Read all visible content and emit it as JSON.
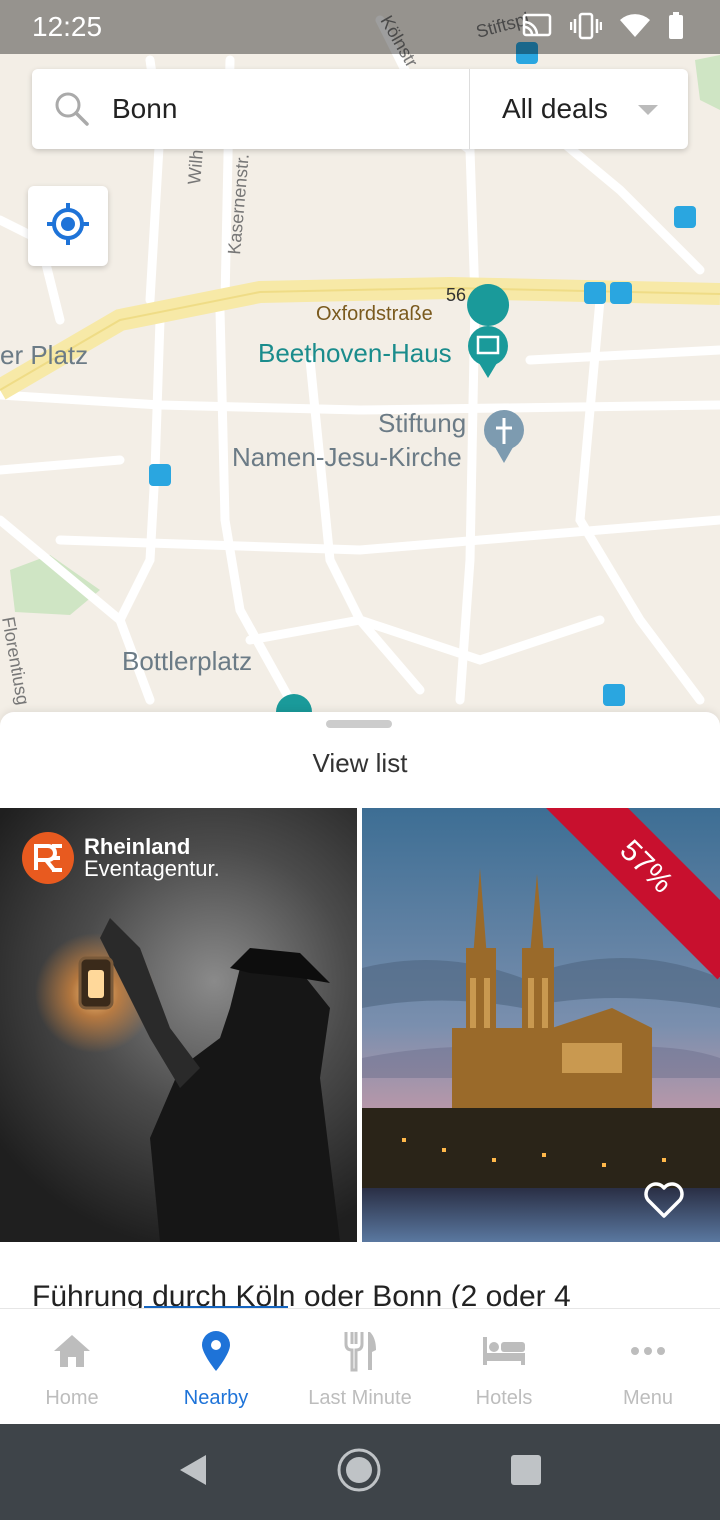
{
  "status_bar": {
    "time": "12:25"
  },
  "search": {
    "query": "Bonn",
    "deals_filter": "All deals"
  },
  "map": {
    "labels": {
      "beethoven": "Beethoven-Haus",
      "church_line1": "Stiftung",
      "church_line2": "Namen-Jesu-Kirche",
      "bottlerplatz": "Bottlerplatz",
      "platz": "er Platz",
      "oxford": "Oxfordstraße",
      "route": "56",
      "kasernen": "Kasernenstr.",
      "wilhelm": "Wilh",
      "koln": "Kölnstr",
      "stifts": "Stiftspl",
      "florentius": "Florentiusg"
    }
  },
  "sheet": {
    "view_list": "View list",
    "card_left": {
      "brand_line1": "Rheinland",
      "brand_line2": "Eventagentur."
    },
    "card_right": {
      "discount": "57%"
    },
    "deal_title": "Führung durch Köln oder Bonn (2 oder 4"
  },
  "nav": {
    "items": [
      {
        "label": "Home",
        "icon": "home-icon"
      },
      {
        "label": "Nearby",
        "icon": "location-pin-icon"
      },
      {
        "label": "Last Minute",
        "icon": "cutlery-icon"
      },
      {
        "label": "Hotels",
        "icon": "bed-icon"
      },
      {
        "label": "Menu",
        "icon": "more-dots-icon"
      }
    ],
    "active": "Nearby"
  },
  "colors": {
    "accent": "#1e73d8",
    "map_teal": "#1a8c8c",
    "ribbon": "#c8102e"
  }
}
